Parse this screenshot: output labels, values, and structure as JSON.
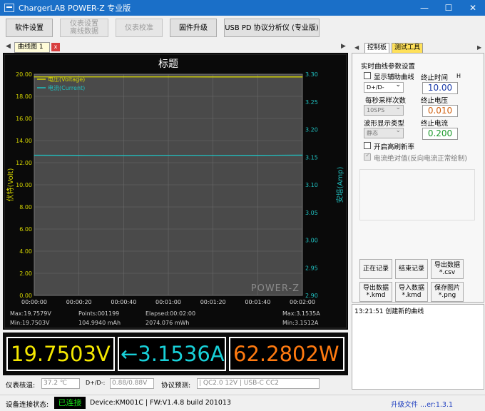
{
  "window": {
    "title": "ChargerLAB POWER-Z 专业版",
    "controls": {
      "minimize": "—",
      "maximize": "☐",
      "close": "✕"
    }
  },
  "toolbar": {
    "settings_label": "软件设置",
    "offline_label": "仪表设置\n离线数据",
    "calibrate_label": "仪表校准",
    "firmware_label": "固件升级",
    "analyzer_label": "USB PD 协议分析仪 (专业版)"
  },
  "tabs": {
    "chart_tab_label": "曲线图 1",
    "chart_tab_close": "x"
  },
  "chart_data": {
    "type": "line",
    "title": "标题",
    "xlabel": "",
    "ylabel": "伏特(Volt)",
    "y2label": "安培(Amp)",
    "x": [
      "00:00:00",
      "00:00:20",
      "00:00:40",
      "00:01:00",
      "00:01:20",
      "00:01:40",
      "00:02:00"
    ],
    "ylim": [
      0,
      20
    ],
    "y2lim": [
      2.9,
      3.3
    ],
    "yticks": [
      "20.00",
      "18.00",
      "16.00",
      "14.00",
      "12.00",
      "10.00",
      "8.00",
      "6.00",
      "4.00",
      "2.00",
      "0.00"
    ],
    "y2ticks": [
      "3.30",
      "3.25",
      "3.20",
      "3.15",
      "3.10",
      "3.05",
      "3.00",
      "2.95",
      "2.90"
    ],
    "series": [
      {
        "name": "电压(Voltage)",
        "axis": "left",
        "color": "#d6d600",
        "values": [
          19.758,
          19.757,
          19.756,
          19.756,
          19.755,
          19.755,
          19.754
        ]
      },
      {
        "name": "电流(Current)",
        "axis": "right",
        "color": "#20c0c0",
        "values": [
          3.1535,
          3.1533,
          3.153,
          3.1534,
          3.1532,
          3.1533,
          3.1536
        ]
      }
    ],
    "grid": true,
    "legend": "top-left",
    "watermark": "POWER-Z",
    "stats": {
      "max_v": "Max:19.7579V",
      "min_v": "Min:19.7503V",
      "points": "Points:001199",
      "mah": "104.9940 mAh",
      "elapsed": "Elapsed:00:02:00",
      "mwh": "2074.076 mWh",
      "max_a": "Max:3.1535A",
      "min_a": "Min:3.1512A"
    }
  },
  "readouts": {
    "voltage": "19.7503V",
    "current": "←3.1536A",
    "power": "62.2802W",
    "voltage_color": "#f5e800",
    "current_color": "#18d0d8",
    "power_color": "#ff7a10"
  },
  "calibration": {
    "label": "仪表核温:",
    "temp": "37.2 ℃",
    "dpdm_label": "D+/D-:",
    "dpdm_value": "0.88/0.88V",
    "protocol_label": "协议预测:",
    "protocol_value": "| QC2.0 12V | USB-C CC2"
  },
  "status": {
    "label": "设备连接状态:",
    "connected": "已连接",
    "device": "Device:KM001C | FW:V1.4.8 build 201013",
    "right_text": "升级文件 ...er:1.3.1"
  },
  "right_panel": {
    "tab_control": "控制板",
    "tab_tools": "测试工具",
    "section_title": "实时曲线参数设置",
    "show_aux_label": "显示辅助曲线",
    "dpdm_select": "D+/D-",
    "sample_label": "每秒采样次数",
    "sample_select": "10SPS",
    "wave_label": "波形显示类型",
    "wave_select": "静态",
    "high_refresh_label": "开启高刷新率",
    "abs_current_label": "电流绝对值(反向电流正常绘制)",
    "end_time_label": "终止时间",
    "end_time_unit": "H",
    "end_time_value": "10.00",
    "end_voltage_label": "终止电压",
    "end_voltage_value": "0.010",
    "end_current_label": "终止电流",
    "end_current_value": "0.200",
    "btn_recording": "正在记录",
    "btn_stop": "结束记录",
    "btn_export_csv": "导出数据\n*.csv",
    "btn_export_kmd": "导出数据\n*.kmd",
    "btn_import_kmd": "导入数据\n*.kmd",
    "btn_save_png": "保存图片\n*.png",
    "log_line": "13:21:51 创建新的曲线"
  }
}
